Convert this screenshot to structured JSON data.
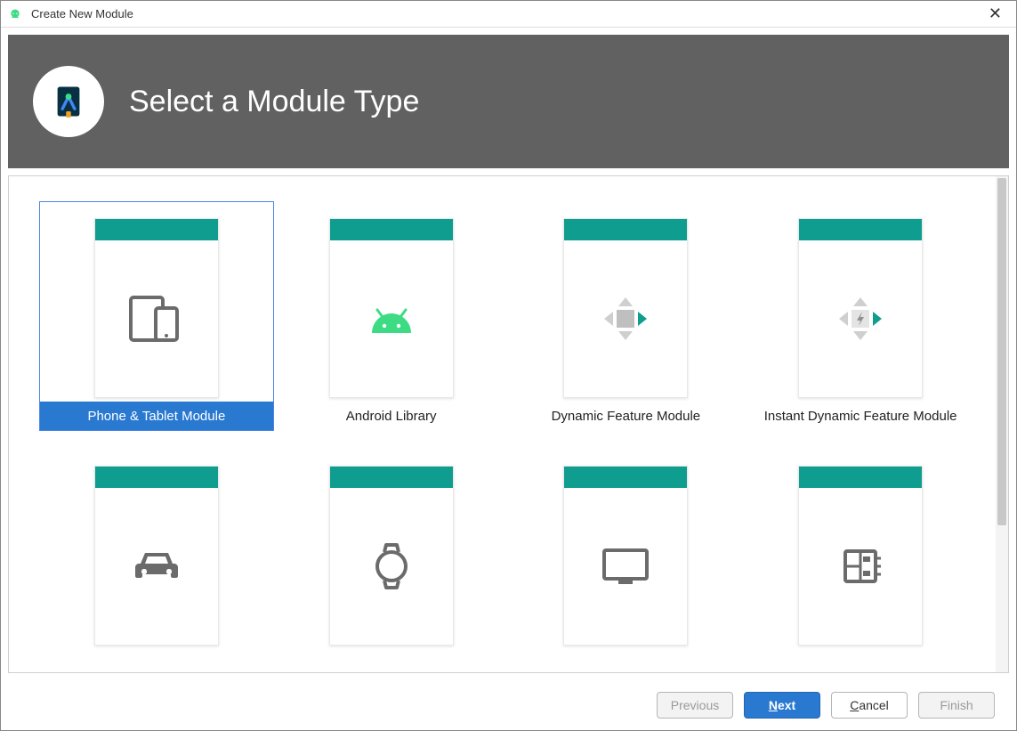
{
  "window": {
    "title": "Create New Module"
  },
  "header": {
    "title": "Select a Module Type"
  },
  "modules": [
    {
      "label": "Phone & Tablet Module",
      "icon": "phone-tablet",
      "selected": true
    },
    {
      "label": "Android Library",
      "icon": "android",
      "selected": false
    },
    {
      "label": "Dynamic Feature Module",
      "icon": "dynamic-feature",
      "selected": false
    },
    {
      "label": "Instant Dynamic Feature Module",
      "icon": "instant-dynamic",
      "selected": false
    },
    {
      "label": "",
      "icon": "car",
      "selected": false
    },
    {
      "label": "",
      "icon": "watch",
      "selected": false
    },
    {
      "label": "",
      "icon": "tv",
      "selected": false
    },
    {
      "label": "",
      "icon": "things",
      "selected": false
    }
  ],
  "footer": {
    "previous": "Previous",
    "next": "Next",
    "cancel": "Cancel",
    "finish": "Finish"
  },
  "colors": {
    "accent": "#2979d1",
    "teal": "#0f9d8f",
    "headerBg": "#616161"
  }
}
